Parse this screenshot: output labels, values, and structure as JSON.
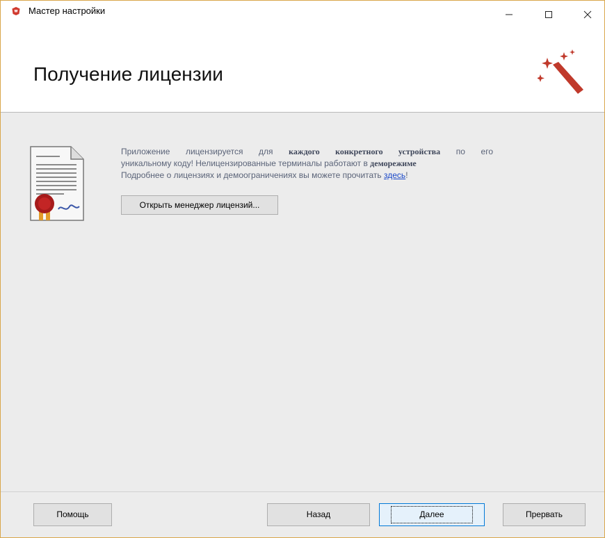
{
  "window": {
    "title": "Мастер настройки",
    "controls": {
      "minimize": "—",
      "maximize": "□",
      "close": "✕"
    }
  },
  "header": {
    "title": "Получение лицензии",
    "icon": "magic-wand-icon"
  },
  "content": {
    "icon": "license-certificate-icon",
    "text": {
      "p1_a": "Приложение лицензируется для",
      "p1_bold": "каждого конкретного устройства",
      "p1_b": "по его",
      "p2_a": "уникальному коду! Нелицензированные терминалы работают в",
      "p2_bold": "деморежиме",
      "p3_a": "Подробнее о лицензиях и демоограничениях вы можете прочитать",
      "p3_link": "здесь",
      "p3_b": "!"
    },
    "license_manager_button": "Открыть менеджер лицензий..."
  },
  "footer": {
    "help": "Помощь",
    "back": "Назад",
    "next": "Далее",
    "abort": "Прервать"
  },
  "colors": {
    "accent": "#c0392b",
    "content_bg": "#ececec",
    "link": "#1a48c8",
    "default_button_border": "#0078d7"
  }
}
